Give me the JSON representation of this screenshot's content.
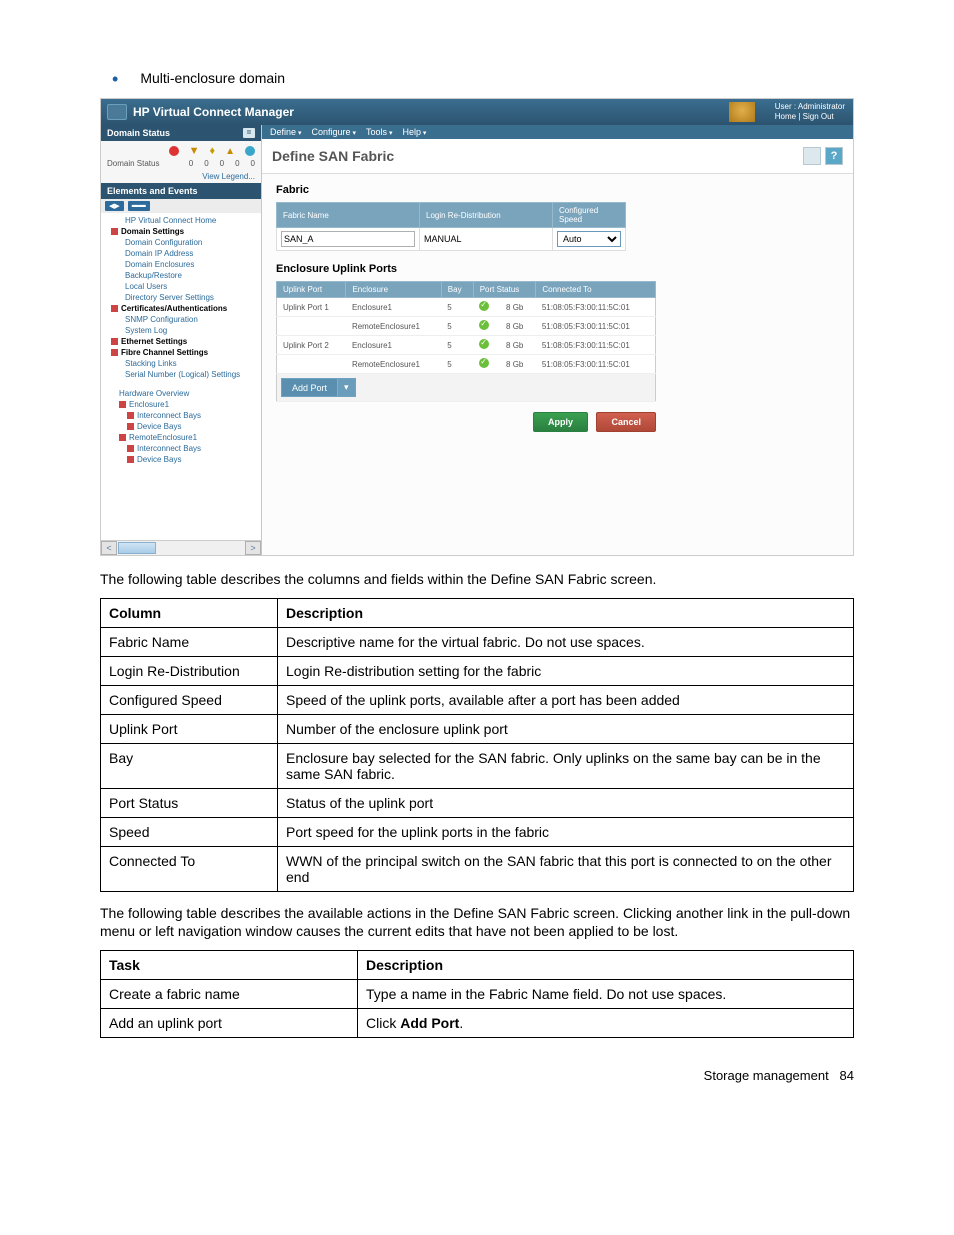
{
  "bullet": "Multi-enclosure domain",
  "app": {
    "title": "HP Virtual Connect Manager",
    "user_label": "User :",
    "user_value": "Administrator",
    "home": "Home",
    "signout": "Sign Out",
    "menubar": [
      "Define",
      "Configure",
      "Tools",
      "Help"
    ],
    "page_title": "Define SAN Fabric",
    "sidebar": {
      "domain_status": "Domain Status",
      "status_label": "Domain Status",
      "status_counts": [
        "0",
        "0",
        "0",
        "0",
        "0"
      ],
      "view_legend": "View Legend...",
      "elements_events": "Elements and Events",
      "tree": [
        {
          "label": "HP Virtual Connect Home",
          "cls": "node",
          "pad": "sub"
        },
        {
          "label": "Domain Settings",
          "cls": "node bold"
        },
        {
          "label": "Domain Configuration",
          "cls": "node",
          "pad": "sub"
        },
        {
          "label": "Domain IP Address",
          "cls": "node",
          "pad": "sub"
        },
        {
          "label": "Domain Enclosures",
          "cls": "node",
          "pad": "sub"
        },
        {
          "label": "Backup/Restore",
          "cls": "node",
          "pad": "sub"
        },
        {
          "label": "Local Users",
          "cls": "node",
          "pad": "sub"
        },
        {
          "label": "Directory Server Settings",
          "cls": "node",
          "pad": "sub"
        },
        {
          "label": "Certificates/Authentications",
          "cls": "node bold"
        },
        {
          "label": "SNMP Configuration",
          "cls": "node",
          "pad": "sub"
        },
        {
          "label": "System Log",
          "cls": "node",
          "pad": "sub"
        },
        {
          "label": "Ethernet Settings",
          "cls": "node bold"
        },
        {
          "label": "Fibre Channel Settings",
          "cls": "node bold"
        },
        {
          "label": "Stacking Links",
          "cls": "node",
          "pad": "sub"
        },
        {
          "label": "Serial Number (Logical) Settings",
          "cls": "node",
          "pad": "sub"
        }
      ],
      "hw": [
        {
          "label": "Hardware Overview",
          "cls": "node",
          "pad": "hwsub0"
        },
        {
          "label": "Enclosure1",
          "cls": "node",
          "pad": "hwsub"
        },
        {
          "label": "Interconnect Bays",
          "cls": "node",
          "pad": "hwsub2"
        },
        {
          "label": "Device Bays",
          "cls": "node",
          "pad": "hwsub2"
        },
        {
          "label": "RemoteEnclosure1",
          "cls": "node",
          "pad": "hwsub"
        },
        {
          "label": "Interconnect Bays",
          "cls": "node",
          "pad": "hwsub2"
        },
        {
          "label": "Device Bays",
          "cls": "node",
          "pad": "hwsub2"
        }
      ]
    },
    "fabric": {
      "section": "Fabric",
      "headers": [
        "Fabric Name",
        "Login Re-Distribution",
        "Configured Speed"
      ],
      "name": "SAN_A",
      "login": "MANUAL",
      "speed": "Auto"
    },
    "ports": {
      "section": "Enclosure Uplink Ports",
      "headers": [
        "Uplink Port",
        "Enclosure",
        "Bay",
        "Port Status",
        "Connected To"
      ],
      "rows": [
        {
          "port": "Uplink Port 1",
          "enc": "Enclosure1",
          "bay": "5",
          "speed": "8 Gb",
          "conn": "51:08:05:F3:00:11:5C:01"
        },
        {
          "port": "",
          "enc": "RemoteEnclosure1",
          "bay": "5",
          "speed": "8 Gb",
          "conn": "51:08:05:F3:00:11:5C:01"
        },
        {
          "port": "Uplink Port 2",
          "enc": "Enclosure1",
          "bay": "5",
          "speed": "8 Gb",
          "conn": "51:08:05:F3:00:11:5C:01"
        },
        {
          "port": "",
          "enc": "RemoteEnclosure1",
          "bay": "5",
          "speed": "8 Gb",
          "conn": "51:08:05:F3:00:11:5C:01"
        }
      ],
      "add_port": "Add Port"
    },
    "apply": "Apply",
    "cancel": "Cancel"
  },
  "para1": "The following table describes the columns and fields within the Define SAN Fabric screen.",
  "table1": {
    "h1": "Column",
    "h2": "Description",
    "rows": [
      [
        "Fabric Name",
        "Descriptive name for the virtual fabric. Do not use spaces."
      ],
      [
        "Login Re-Distribution",
        "Login Re-distribution setting for the fabric"
      ],
      [
        "Configured Speed",
        "Speed of the uplink ports, available after a port has been added"
      ],
      [
        "Uplink Port",
        "Number of the enclosure uplink port"
      ],
      [
        "Bay",
        "Enclosure bay selected for the SAN fabric. Only uplinks on the same bay can be in the same SAN fabric."
      ],
      [
        "Port Status",
        "Status of the uplink port"
      ],
      [
        "Speed",
        "Port speed for the uplink ports in the fabric"
      ],
      [
        "Connected To",
        "WWN of the principal switch on the SAN fabric that this port is connected to on the other end"
      ]
    ]
  },
  "para2": "The following table describes the available actions in the Define SAN Fabric screen. Clicking another link in the pull-down menu or left navigation window causes the current edits that have not been applied to be lost.",
  "table2": {
    "h1": "Task",
    "h2": "Description",
    "rows": [
      [
        "Create a fabric name",
        "Type a name in the Fabric Name field. Do not use spaces."
      ],
      [
        "Add an uplink port",
        "Click <b>Add Port</b>."
      ]
    ]
  },
  "footer_label": "Storage management",
  "footer_page": "84"
}
